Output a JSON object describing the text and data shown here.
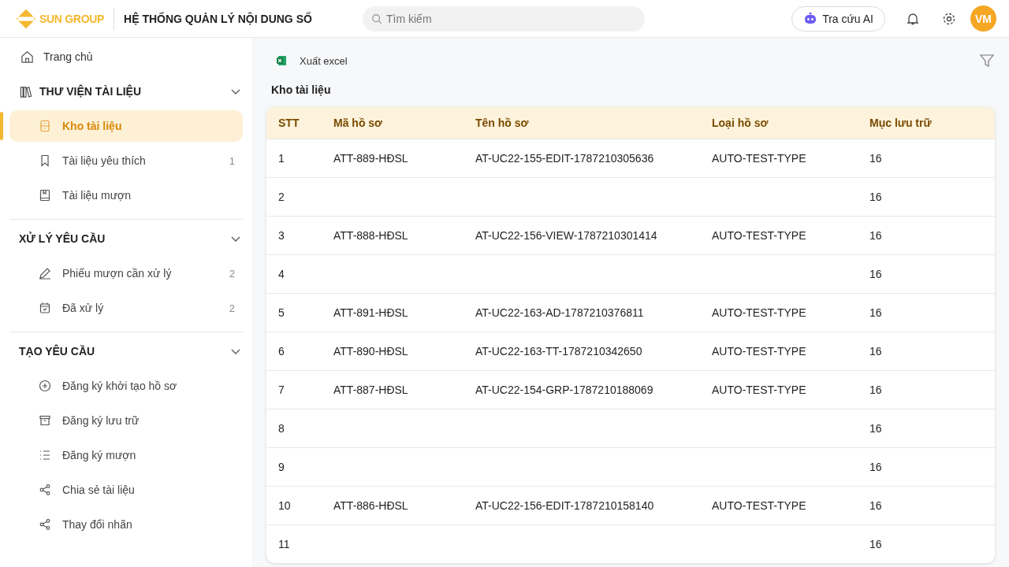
{
  "header": {
    "logo": "SUN GROUP",
    "title": "HỆ THỐNG QUẢN LÝ NỘI DUNG SỐ",
    "search": {
      "placeholder": "Tìm kiếm"
    },
    "ai_button": "Tra cứu AI",
    "avatar": "VM"
  },
  "sidebar": {
    "home": "Trang chủ",
    "sections": [
      {
        "title": "THƯ VIỆN TÀI LIỆU",
        "expanded": true,
        "items": [
          {
            "label": "Kho tài liệu",
            "selected": true
          },
          {
            "label": "Tài liệu yêu thích",
            "count": "1",
            "selected": false
          },
          {
            "label": "Tài liệu mượn",
            "selected": false
          }
        ]
      },
      {
        "title": "XỬ LÝ YÊU CẦU",
        "expanded": true,
        "items": [
          {
            "label": "Phiếu mượn cần xử lý",
            "count": "2",
            "selected": false
          },
          {
            "label": "Đã xử lý",
            "count": "2",
            "selected": false
          }
        ]
      },
      {
        "title": "TẠO YÊU CẦU",
        "expanded": true,
        "items": [
          {
            "label": "Đăng ký khởi tạo hồ sơ",
            "selected": false
          },
          {
            "label": "Đăng ký lưu trữ",
            "selected": false
          },
          {
            "label": "Đăng ký mượn",
            "selected": false
          },
          {
            "label": "Chia sẻ tài liệu",
            "selected": false
          },
          {
            "label": "Thay đổi nhãn",
            "selected": false
          }
        ]
      }
    ]
  },
  "toolbar": {
    "export": "Xuất excel"
  },
  "page_title": "Kho tài liệu",
  "table": {
    "columns": [
      "STT",
      "Mã hồ sơ",
      "Tên hồ sơ",
      "Loại hồ sơ",
      "Mục lưu trữ"
    ],
    "rows": [
      {
        "stt": "1",
        "code": "ATT-889-HĐSL",
        "name": "AT-UC22-155-EDIT-1787210305636",
        "type": "AUTO-TEST-TYPE",
        "storage": "16"
      },
      {
        "stt": "2",
        "storage": "16"
      },
      {
        "stt": "3",
        "code": "ATT-888-HĐSL",
        "name": "AT-UC22-156-VIEW-1787210301414",
        "type": "AUTO-TEST-TYPE",
        "storage": "16"
      },
      {
        "stt": "4",
        "storage": "16"
      },
      {
        "stt": "5",
        "code": "ATT-891-HĐSL",
        "name": "AT-UC22-163-AD-1787210376811",
        "type": "AUTO-TEST-TYPE",
        "storage": "16"
      },
      {
        "stt": "6",
        "code": "ATT-890-HĐSL",
        "name": "AT-UC22-163-TT-1787210342650",
        "type": "AUTO-TEST-TYPE",
        "storage": "16"
      },
      {
        "stt": "7",
        "code": "ATT-887-HĐSL",
        "name": "AT-UC22-154-GRP-1787210188069",
        "type": "AUTO-TEST-TYPE",
        "storage": "16"
      },
      {
        "stt": "8",
        "storage": "16"
      },
      {
        "stt": "9",
        "storage": "16"
      },
      {
        "stt": "10",
        "code": "ATT-886-HĐSL",
        "name": "AT-UC22-156-EDIT-1787210158140",
        "type": "AUTO-TEST-TYPE",
        "storage": "16"
      },
      {
        "stt": "11",
        "storage": "16"
      }
    ]
  }
}
